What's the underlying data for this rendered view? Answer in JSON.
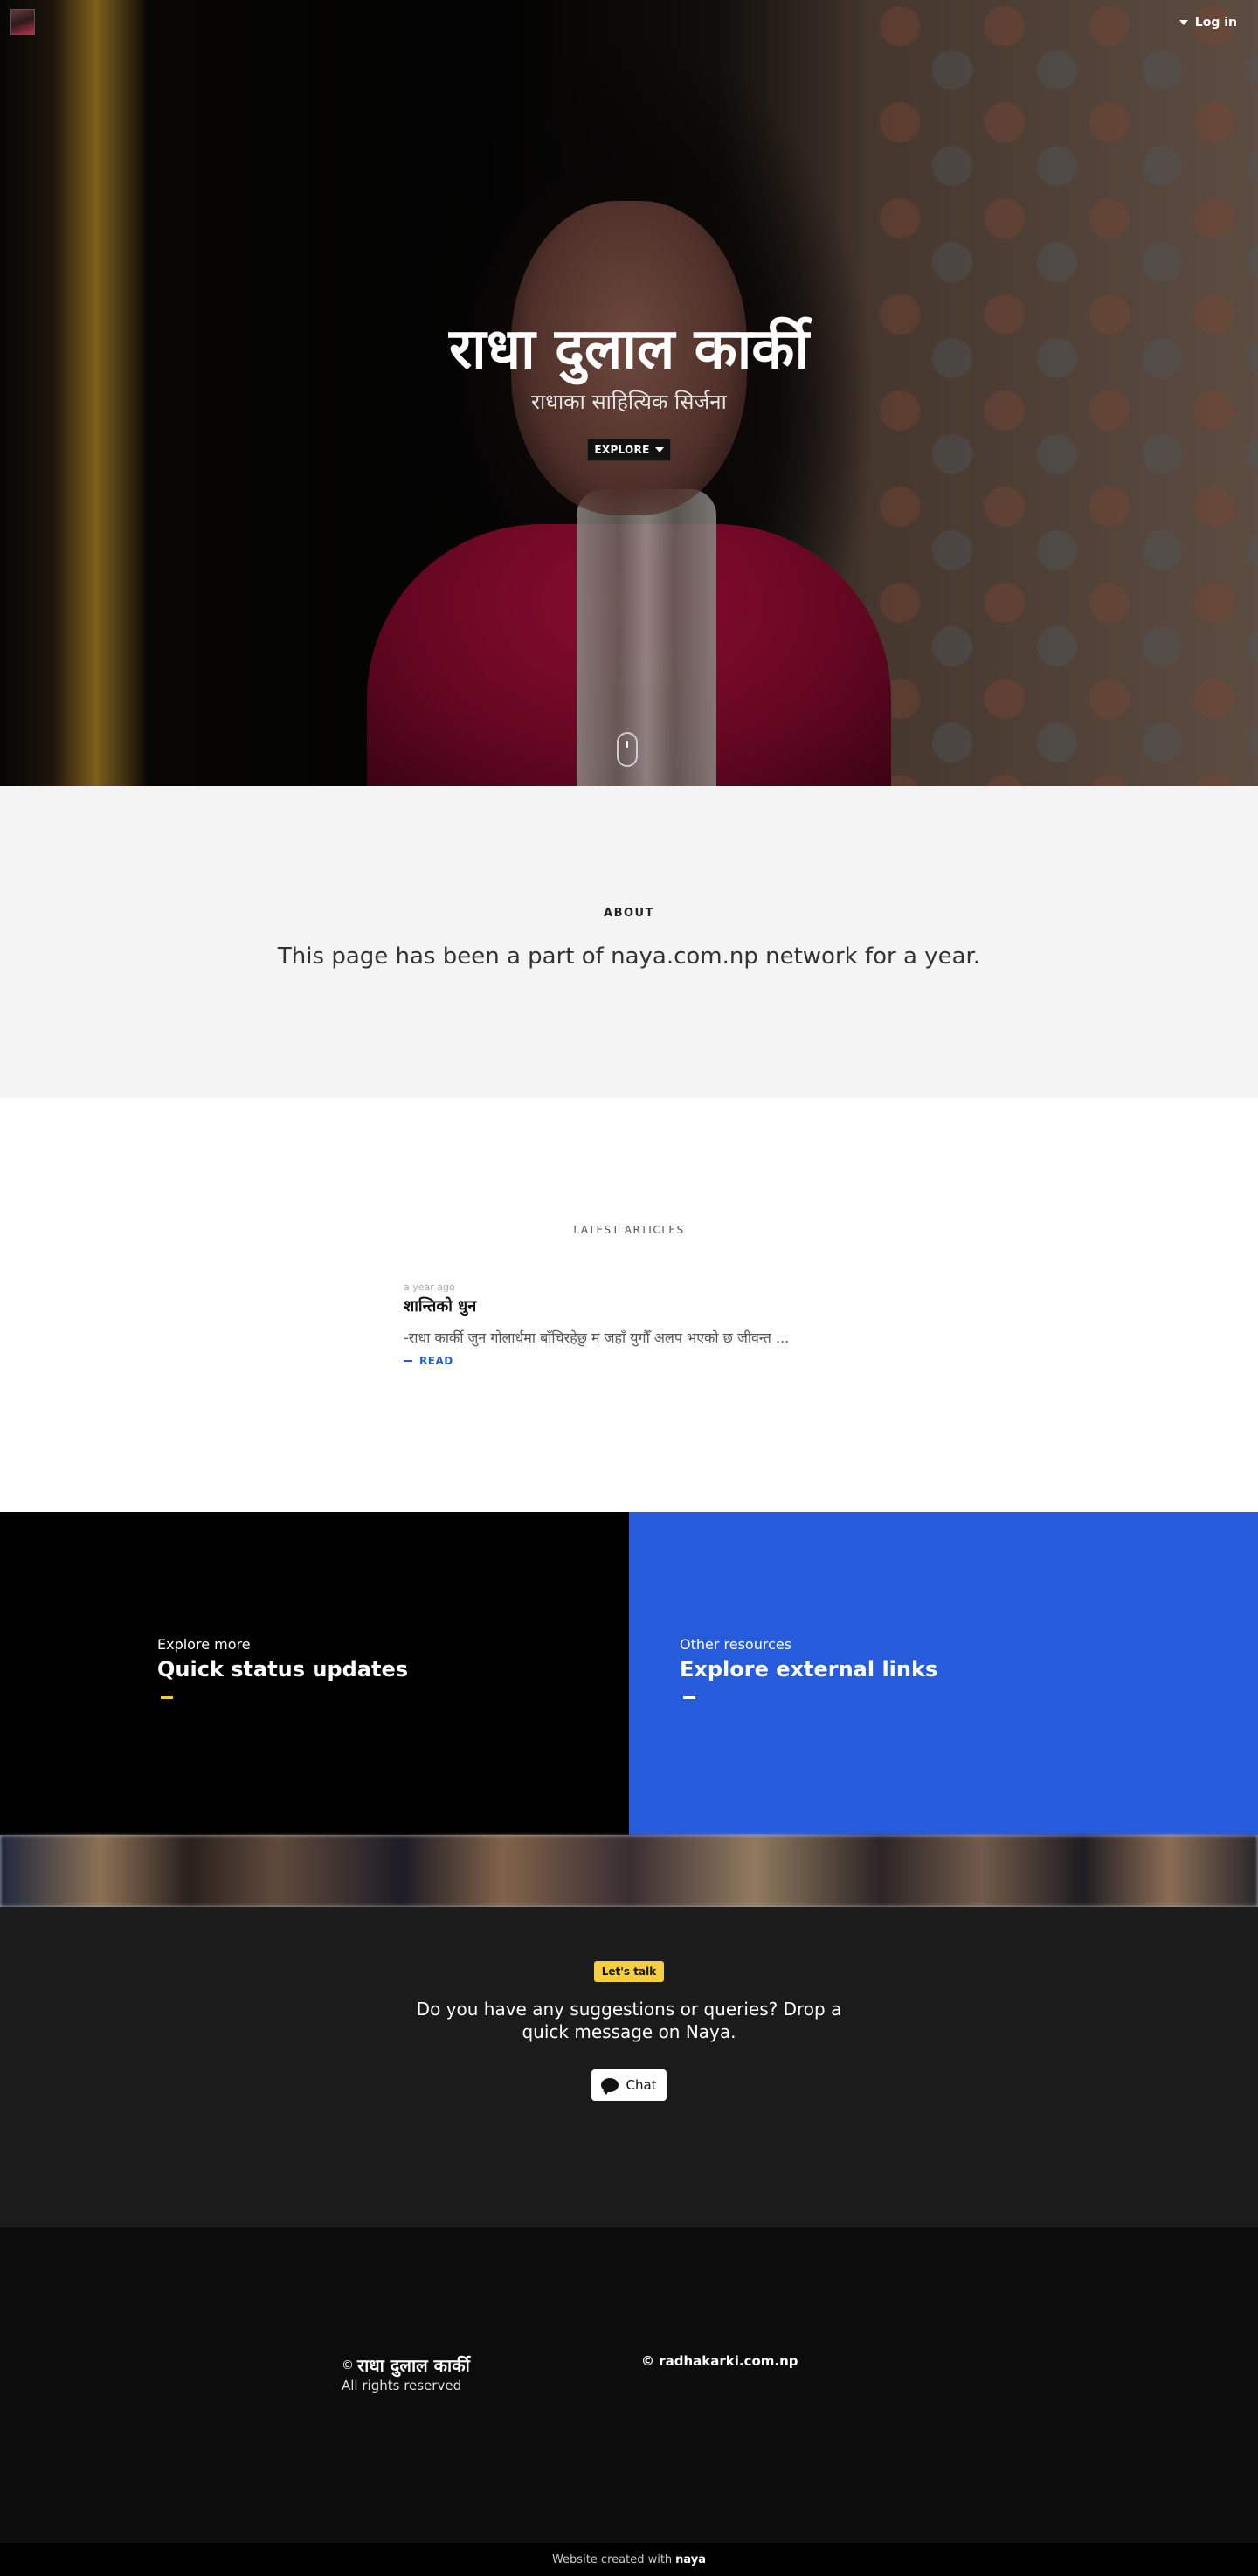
{
  "header": {
    "login_label": "Log in"
  },
  "hero": {
    "title": "राधा दुलाल कार्की",
    "subtitle": "राधाका साहित्यिक सिर्जना",
    "explore_label": "EXPLORE"
  },
  "about": {
    "label": "ABOUT",
    "text": "This page has been a part of naya.com.np network for a year."
  },
  "articles": {
    "label": "LATEST ARTICLES",
    "items": [
      {
        "time": "a year ago",
        "title": "शान्तिको धुन",
        "excerpt": "-राधा कार्की जुन गोलार्धमा बाँचिरहेछु म जहाँ युगौँ अलप भएको छ जीवन्त ...",
        "read_label": "READ"
      }
    ]
  },
  "tiles": {
    "left": {
      "kicker": "Explore more",
      "title": "Quick status updates"
    },
    "right": {
      "kicker": "Other resources",
      "title": "Explore external links"
    }
  },
  "contact": {
    "badge": "Let's talk",
    "text": "Do you have any suggestions or queries? Drop a quick message on Naya.",
    "chat_label": "Chat"
  },
  "footer": {
    "copyright_symbol": "©",
    "brand": "राधा दुलाल कार्की",
    "rights": "All rights reserved",
    "domain": "© radhakarki.com.np"
  },
  "credit": {
    "prefix": "Website created with",
    "brand": "naya"
  },
  "colors": {
    "accent_blue": "#265cdb",
    "badge_yellow": "#f5cf3f",
    "link_blue": "#2a5bd7"
  }
}
